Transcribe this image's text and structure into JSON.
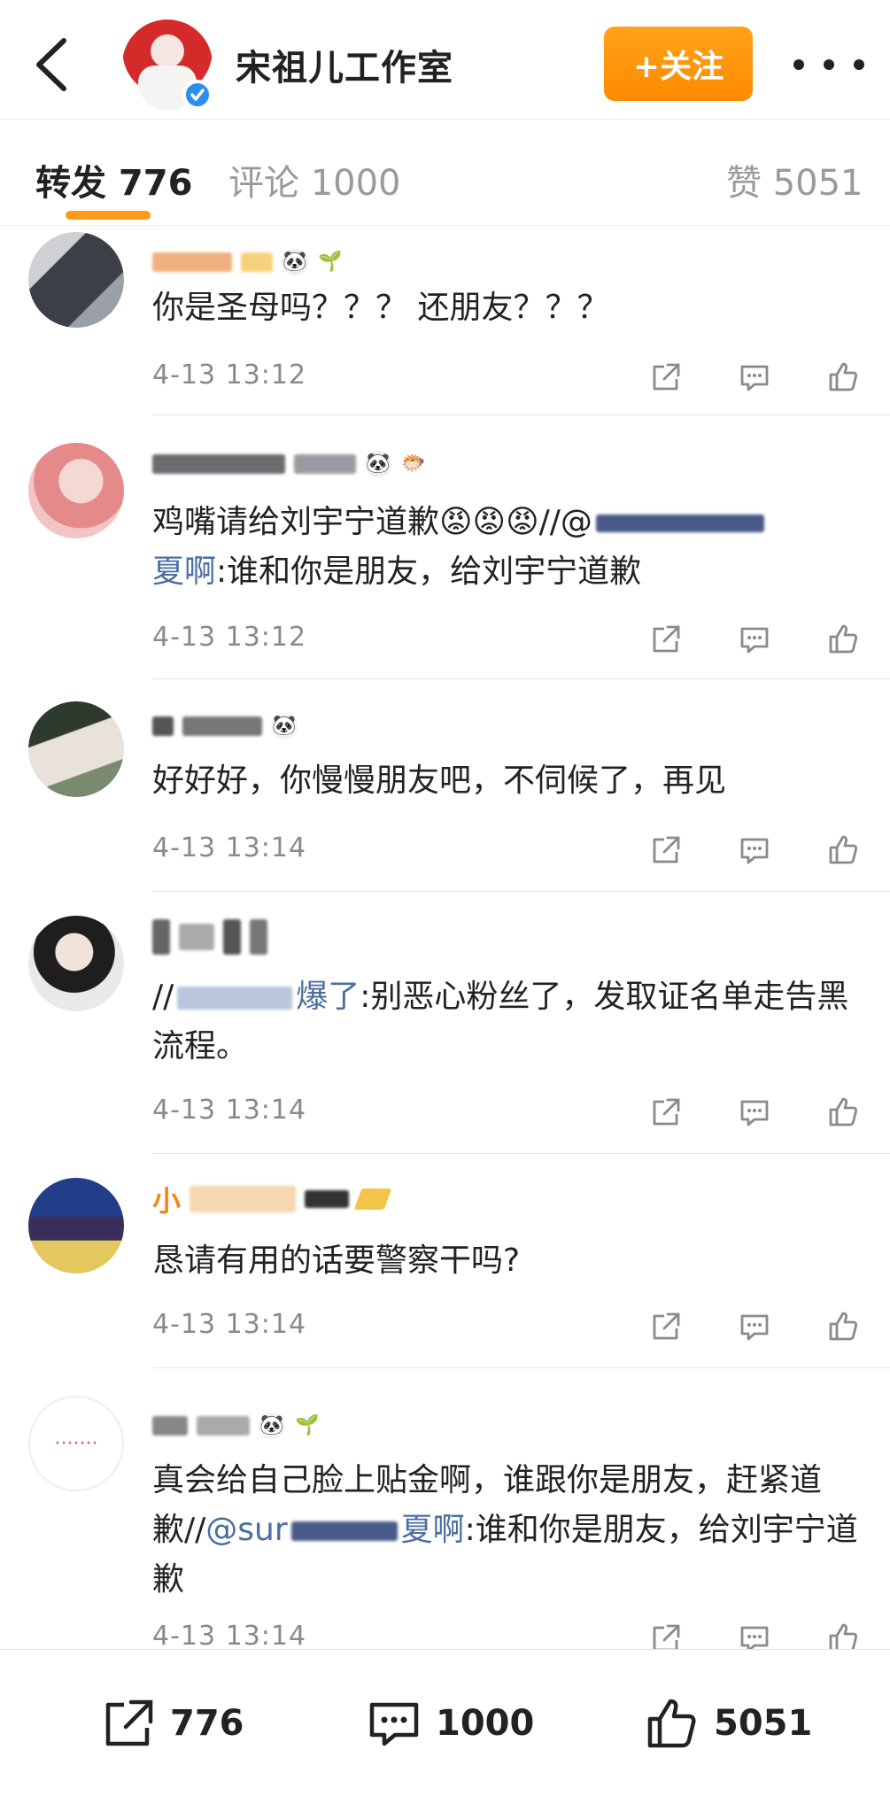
{
  "header": {
    "account_name": "宋祖儿工作室",
    "follow_label": "+关注",
    "brand_color": "#ff8a00"
  },
  "tabs": [
    {
      "label": "转发 776",
      "active": true
    },
    {
      "label": "评论 1000",
      "active": false
    },
    {
      "label": "赞 5051",
      "active": false
    }
  ],
  "comments": [
    {
      "text": "你是圣母吗？？？ 还朋友？？？",
      "time": "4-13 13:12"
    },
    {
      "text_prefix": "鸡嘴请给刘宇宁道歉",
      "text_mid": "//@",
      "link_tail": "夏啊",
      "text_suffix": ":谁和你是朋友，给刘宇宁道歉",
      "time": "4-13 13:12"
    },
    {
      "text": "好好好，你慢慢朋友吧，不伺候了，再见",
      "time": "4-13 13:14"
    },
    {
      "text_prefix": "//",
      "link_tail": "爆了",
      "text_suffix": ":别恶心粉丝了，发取证名单走告黑流程。",
      "time": "4-13 13:14"
    },
    {
      "name_fragment": "小",
      "text": "恳请有用的话要警察干吗?",
      "time": "4-13 13:14"
    },
    {
      "avatar_text": "·······",
      "text_prefix": "真会给自己脸上贴金啊，谁跟你是朋友，赶紧道歉//",
      "link_head": "@sur",
      "link_tail": "夏啊",
      "text_suffix": ":谁和你是朋友，给刘宇宁道歉",
      "time": "4-13 13:14"
    }
  ],
  "bottom_bar": {
    "reposts": "776",
    "comments": "1000",
    "likes": "5051"
  }
}
